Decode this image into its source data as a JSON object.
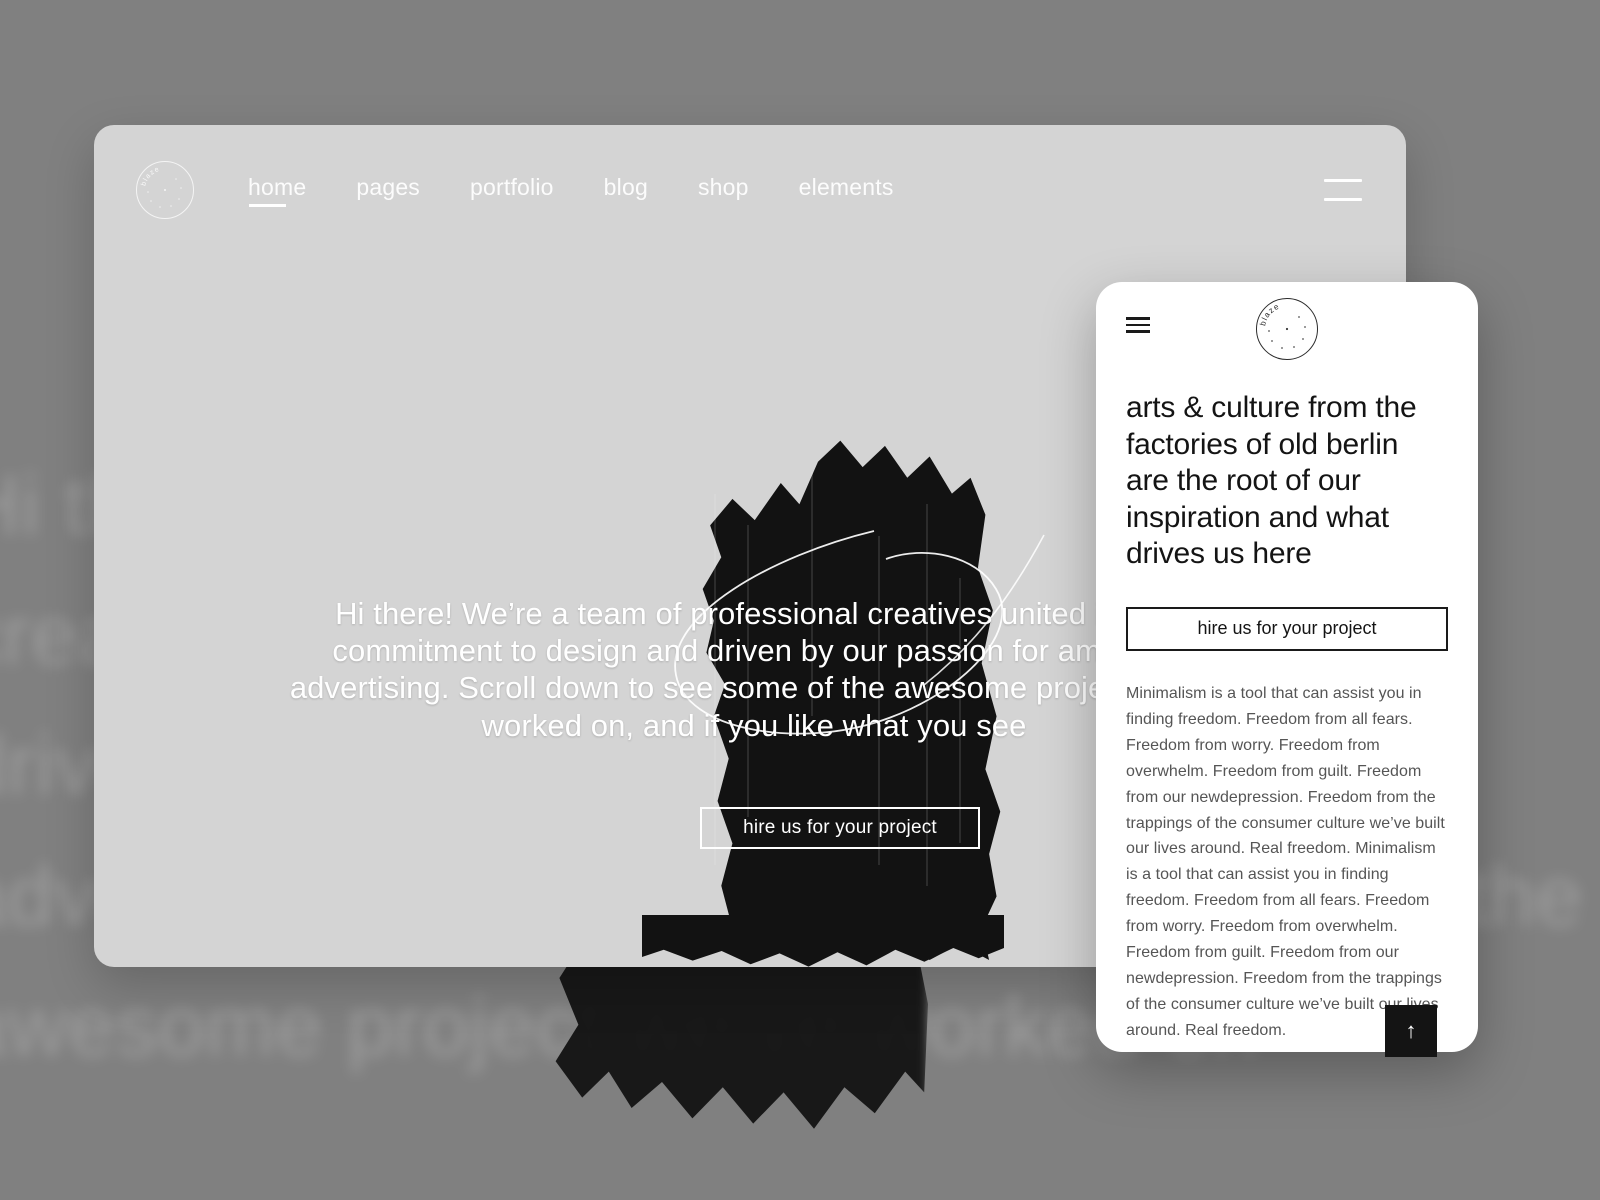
{
  "brand": {
    "name": "blaze"
  },
  "background": {
    "ghost_text": "Hi there! We’re a team of professional creatives united in our commitment and driven by our passion for amazing advertising. Scroll down to see some of the awesome project we’ve worked on",
    "page_color": "#808080",
    "card_color": "#d4d4d4",
    "phone_color": "#ffffff",
    "ink_color": "#121212"
  },
  "desktop": {
    "nav": {
      "logo_label": "blaze",
      "items": [
        {
          "label": "home",
          "active": true
        },
        {
          "label": "pages",
          "active": false
        },
        {
          "label": "portfolio",
          "active": false
        },
        {
          "label": "blog",
          "active": false
        },
        {
          "label": "shop",
          "active": false
        },
        {
          "label": "elements",
          "active": false
        }
      ],
      "menu_toggle_label": "menu"
    },
    "hero": {
      "headline": "Hi there! We’re a team of professional creatives united in our commitment to design and driven by our passion for amazing advertising. Scroll down to see some of the awesome project we’ve worked on, and if you like what you see",
      "cta_label": "hire us for your project"
    }
  },
  "mobile": {
    "nav": {
      "logo_label": "blaze",
      "menu_toggle_label": "menu"
    },
    "headline": "arts & culture from the factories of old berlin are the root of our inspiration and what drives us here",
    "cta_label": "hire us for your project",
    "paragraph": "Minimalism is a tool that can assist you in finding freedom. Freedom from all fears. Freedom from worry. Freedom from overwhelm. Freedom from guilt. Freedom from our newdepression. Freedom from the trappings of the consumer culture we’ve built our lives around. Real freedom. Minimalism is a tool that can assist you in finding freedom. Freedom from all fears. Freedom from worry. Freedom from overwhelm. Freedom from guilt. Freedom from our newdepression. Freedom from the trappings of the consumer culture we’ve built our lives around. Real freedom.",
    "scroll_top_label": "↑"
  }
}
